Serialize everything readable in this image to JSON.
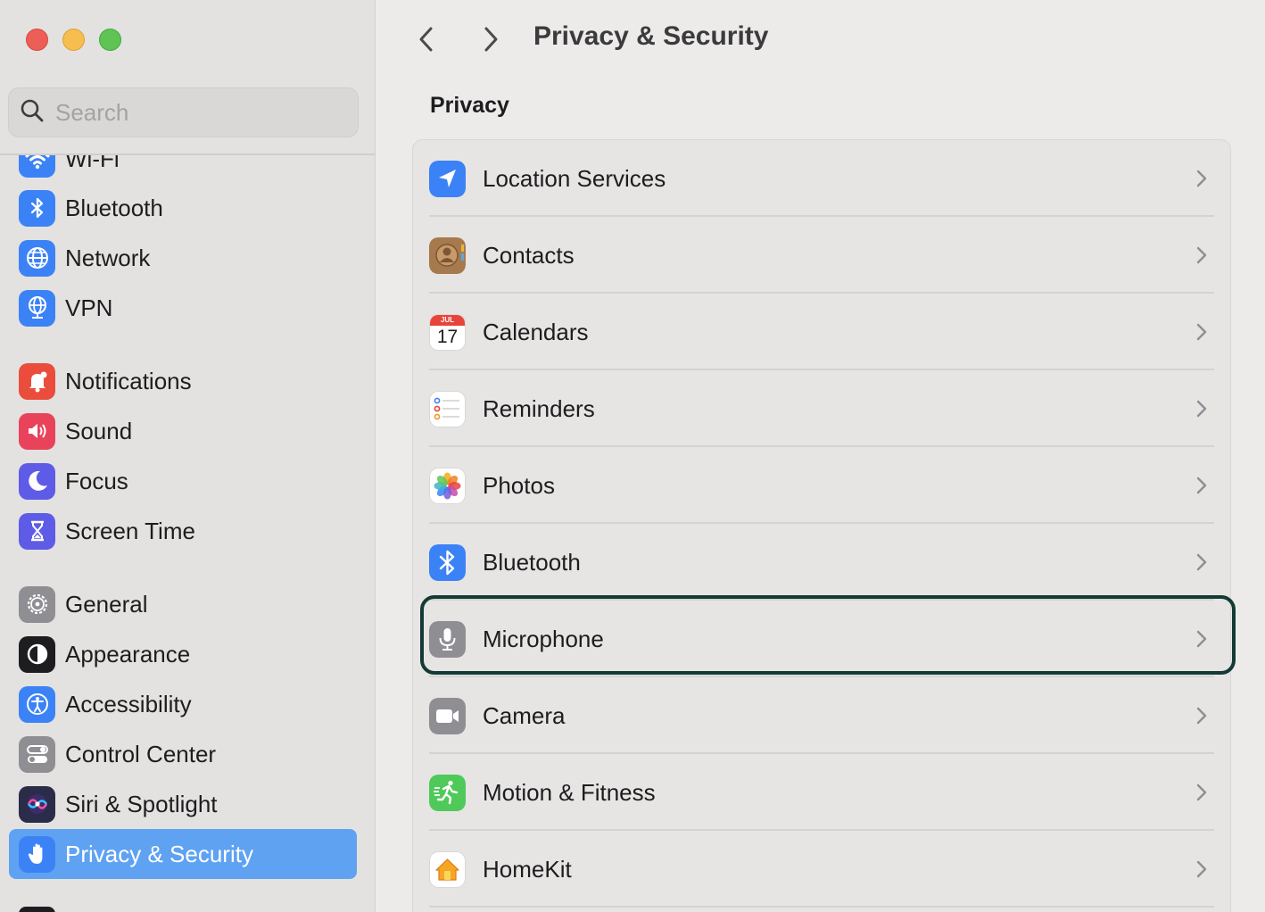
{
  "window": {
    "buttons": [
      "close",
      "minimize",
      "maximize"
    ]
  },
  "search": {
    "placeholder": "Search"
  },
  "sidebar": {
    "items": [
      {
        "label": "Wi-Fi",
        "icon": "wifi-icon",
        "color": "#3b82f6"
      },
      {
        "label": "Bluetooth",
        "icon": "bluetooth-icon",
        "color": "#3b82f6"
      },
      {
        "label": "Network",
        "icon": "globe-icon",
        "color": "#3b82f6"
      },
      {
        "label": "VPN",
        "icon": "vpn-globe-icon",
        "color": "#3b82f6"
      },
      {
        "label": "Notifications",
        "icon": "bell-icon",
        "color": "#eb4d3d"
      },
      {
        "label": "Sound",
        "icon": "speaker-icon",
        "color": "#e8435a"
      },
      {
        "label": "Focus",
        "icon": "moon-icon",
        "color": "#5e5ce6"
      },
      {
        "label": "Screen Time",
        "icon": "hourglass-icon",
        "color": "#5e5ce6"
      },
      {
        "label": "General",
        "icon": "gear-icon",
        "color": "#8e8e93"
      },
      {
        "label": "Appearance",
        "icon": "appearance-icon",
        "color": "#1d1d1f"
      },
      {
        "label": "Accessibility",
        "icon": "accessibility-icon",
        "color": "#3b82f6"
      },
      {
        "label": "Control Center",
        "icon": "toggles-icon",
        "color": "#8e8e93"
      },
      {
        "label": "Siri & Spotlight",
        "icon": "siri-icon",
        "color": "#2b2b4a"
      },
      {
        "label": "Privacy & Security",
        "icon": "hand-icon",
        "color": "#3b82f6",
        "selected": true
      }
    ],
    "selected_color": "#5fa2f2"
  },
  "header": {
    "back": "back-chevron-icon",
    "forward": "forward-chevron-icon",
    "title": "Privacy & Security"
  },
  "main": {
    "section_title": "Privacy",
    "rows": [
      {
        "label": "Location Services",
        "icon": "location-arrow-icon"
      },
      {
        "label": "Contacts",
        "icon": "contacts-icon"
      },
      {
        "label": "Calendars",
        "icon": "calendar-icon",
        "month": "JUL",
        "day": "17"
      },
      {
        "label": "Reminders",
        "icon": "reminders-icon"
      },
      {
        "label": "Photos",
        "icon": "photos-icon"
      },
      {
        "label": "Bluetooth",
        "icon": "bluetooth-icon"
      },
      {
        "label": "Microphone",
        "icon": "microphone-icon",
        "focused": true
      },
      {
        "label": "Camera",
        "icon": "camera-icon"
      },
      {
        "label": "Motion & Fitness",
        "icon": "running-icon"
      },
      {
        "label": "HomeKit",
        "icon": "home-icon"
      }
    ],
    "focus_color": "#143a35"
  }
}
